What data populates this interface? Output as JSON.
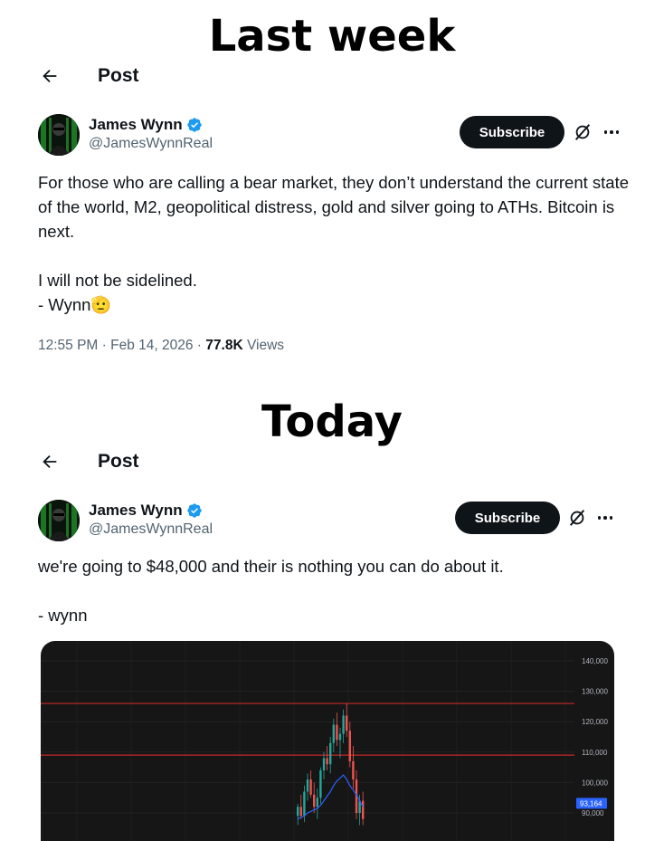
{
  "headings": {
    "last_week": "Last week",
    "today": "Today"
  },
  "post1": {
    "header_title": "Post",
    "author": {
      "name": "James Wynn",
      "handle": "@JamesWynnReal",
      "verified": true
    },
    "subscribe_label": "Subscribe",
    "text": "For those who are calling a bear market, they don’t understand the current state of the world, M2, geopolitical distress, gold and silver going to ATHs. Bitcoin is next.\n\nI will not be sidelined.\n- Wynn🫡",
    "time": "12:55 PM",
    "date": "Feb 14, 2026",
    "views_count": "77.8K",
    "views_label": "Views"
  },
  "post2": {
    "header_title": "Post",
    "author": {
      "name": "James Wynn",
      "handle": "@JamesWynnReal",
      "verified": true
    },
    "subscribe_label": "Subscribe",
    "text": "we're going to $48,000 and their is nothing you can do about it.\n\n- wynn"
  },
  "chart_data": {
    "type": "candlestick",
    "y_ticks": [
      "140,000",
      "130,000",
      "120,000",
      "110,000",
      "100,000",
      "90,000"
    ],
    "y_tick_values": [
      140000,
      130000,
      120000,
      110000,
      100000,
      90000
    ],
    "ylim": [
      86000,
      145000
    ],
    "horizontal_lines": [
      126000,
      109000
    ],
    "price_badge": "93,164",
    "price_badge_value": 93164,
    "candles": [
      {
        "o": 89000,
        "h": 93000,
        "l": 86000,
        "c": 92000
      },
      {
        "o": 92000,
        "h": 96000,
        "l": 88000,
        "c": 89000
      },
      {
        "o": 89000,
        "h": 99000,
        "l": 87000,
        "c": 97000
      },
      {
        "o": 97000,
        "h": 103000,
        "l": 94000,
        "c": 101000
      },
      {
        "o": 101000,
        "h": 104000,
        "l": 95000,
        "c": 96000
      },
      {
        "o": 96000,
        "h": 100000,
        "l": 90000,
        "c": 92000
      },
      {
        "o": 92000,
        "h": 98000,
        "l": 88000,
        "c": 95000
      },
      {
        "o": 95000,
        "h": 105000,
        "l": 93000,
        "c": 104000
      },
      {
        "o": 104000,
        "h": 110000,
        "l": 101000,
        "c": 108000
      },
      {
        "o": 108000,
        "h": 112000,
        "l": 104000,
        "c": 106000
      },
      {
        "o": 106000,
        "h": 115000,
        "l": 103000,
        "c": 113000
      },
      {
        "o": 113000,
        "h": 121000,
        "l": 110000,
        "c": 119000
      },
      {
        "o": 119000,
        "h": 123000,
        "l": 112000,
        "c": 114000
      },
      {
        "o": 114000,
        "h": 118000,
        "l": 108000,
        "c": 116000
      },
      {
        "o": 116000,
        "h": 124000,
        "l": 113000,
        "c": 122000
      },
      {
        "o": 122000,
        "h": 126000,
        "l": 115000,
        "c": 117000
      },
      {
        "o": 117000,
        "h": 120000,
        "l": 105000,
        "c": 107000
      },
      {
        "o": 107000,
        "h": 112000,
        "l": 98000,
        "c": 101000
      },
      {
        "o": 101000,
        "h": 104000,
        "l": 88000,
        "c": 90000
      },
      {
        "o": 90000,
        "h": 96000,
        "l": 86000,
        "c": 94000
      },
      {
        "o": 94000,
        "h": 97000,
        "l": 86000,
        "c": 88000
      }
    ],
    "moving_average": [
      88000,
      88500,
      89000,
      90000,
      90500,
      91000,
      91500,
      92500,
      94000,
      95500,
      97000,
      99000,
      100500,
      101500,
      102500,
      101000,
      99000,
      97500,
      96000,
      94000,
      92000
    ],
    "colors": {
      "background": "#161616",
      "up": "#26a69a",
      "down": "#ef5350",
      "ma": "#2962ff",
      "level": "#c62828",
      "badge": "#2962ff",
      "tick": "#b2b5be"
    }
  }
}
